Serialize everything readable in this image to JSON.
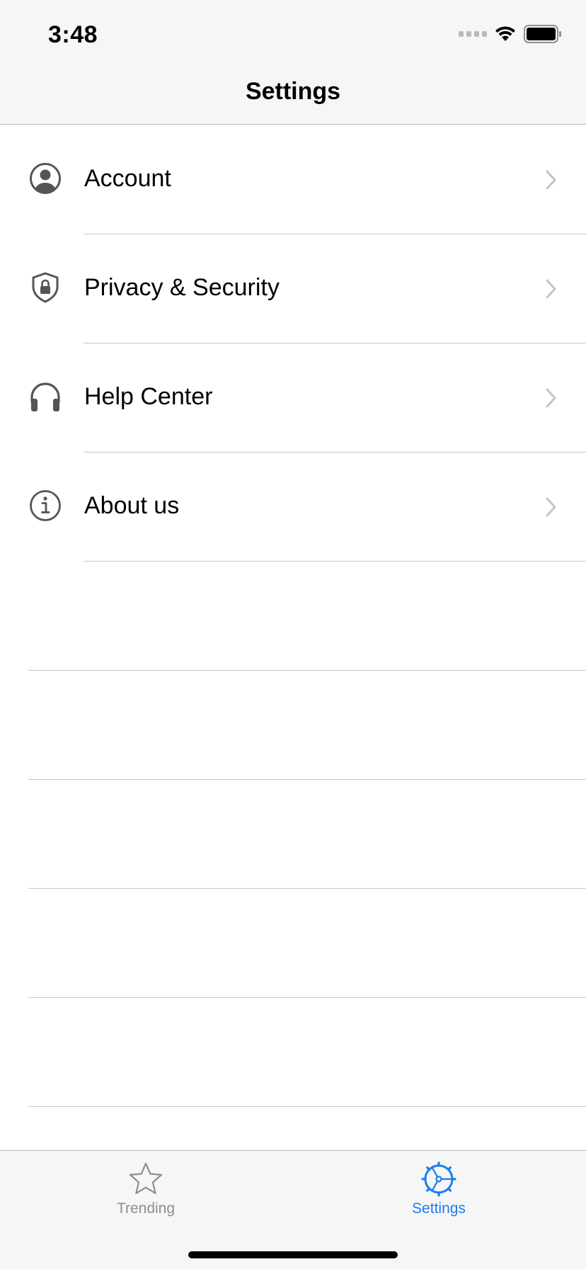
{
  "status_bar": {
    "time": "3:48"
  },
  "nav": {
    "title": "Settings"
  },
  "settings_items": [
    {
      "label": "Account",
      "icon": "person-circle-icon"
    },
    {
      "label": "Privacy & Security",
      "icon": "lock-shield-icon"
    },
    {
      "label": "Help Center",
      "icon": "headphones-icon"
    },
    {
      "label": "About us",
      "icon": "info-circle-icon"
    }
  ],
  "tab_bar": {
    "tabs": [
      {
        "label": "Trending",
        "icon": "star-icon",
        "selected": false
      },
      {
        "label": "Settings",
        "icon": "gear-icon",
        "selected": true
      }
    ]
  },
  "colors": {
    "accent": "#1a7cf0",
    "inactive": "#8e8e93",
    "icon": "#555555",
    "chevron": "#c4c4c7",
    "separator": "#c8c7cc",
    "bar_background": "#f6f6f6"
  }
}
